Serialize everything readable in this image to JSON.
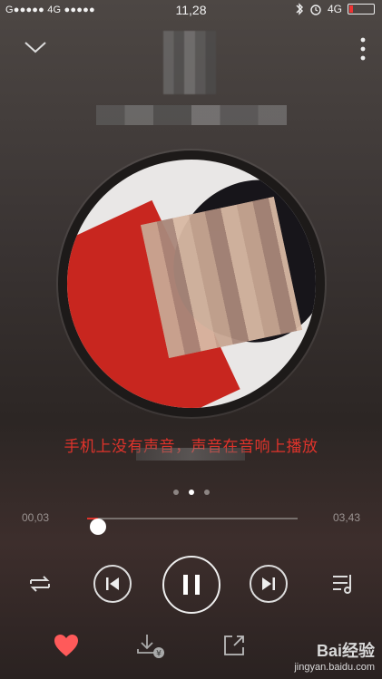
{
  "status_bar": {
    "carrier_left": "G●●●●● 4G ●●●●●",
    "time": "11,28",
    "network_right": "4G",
    "icons": [
      "bluetooth-icon",
      "alarm-icon",
      "battery-icon"
    ]
  },
  "lyric": "手机上没有声音，声音在音响上播放",
  "pager": {
    "count": 3,
    "active_index": 1
  },
  "progress": {
    "elapsed": "00,03",
    "total": "03,43",
    "fraction": 0.05
  },
  "controls": {
    "repeat_icon": "repeat-icon",
    "prev_icon": "previous-icon",
    "play_pause_icon": "pause-icon",
    "next_icon": "next-icon",
    "playlist_icon": "playlist-icon"
  },
  "bottom_bar": {
    "like_icon": "heart-icon",
    "download_icon": "download-icon",
    "share_icon": "share-icon"
  },
  "watermark": {
    "brand": "Bai经验",
    "url": "jingyan.baidu.com"
  },
  "colors": {
    "accent": "#e0332b",
    "heart": "#ff5a5a"
  }
}
